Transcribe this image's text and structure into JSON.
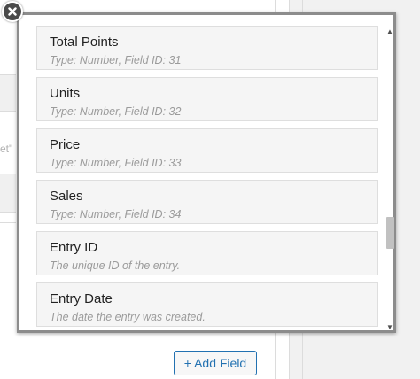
{
  "field_list": {
    "items": [
      {
        "title": "Total Points",
        "subtitle": "Type: Number, Field ID: 31"
      },
      {
        "title": "Units",
        "subtitle": "Type: Number, Field ID: 32"
      },
      {
        "title": "Price",
        "subtitle": "Type: Number, Field ID: 33"
      },
      {
        "title": "Sales",
        "subtitle": "Type: Number, Field ID: 34"
      },
      {
        "title": "Entry ID",
        "subtitle": "The unique ID of the entry."
      },
      {
        "title": "Entry Date",
        "subtitle": "The date the entry was created."
      }
    ],
    "scroll_position": 0.62
  },
  "background": {
    "partial_text": "et\""
  },
  "actions": {
    "add_field_label": "+ Add Field"
  },
  "icons": {
    "close": "close-icon",
    "scroll_up": "scroll-up-arrow-icon",
    "scroll_down": "scroll-down-arrow-icon"
  },
  "colors": {
    "accent": "#2271b1",
    "popup_border": "#8c8c8c",
    "item_background": "#f5f5f5",
    "close_button": "#4a4a4a"
  }
}
